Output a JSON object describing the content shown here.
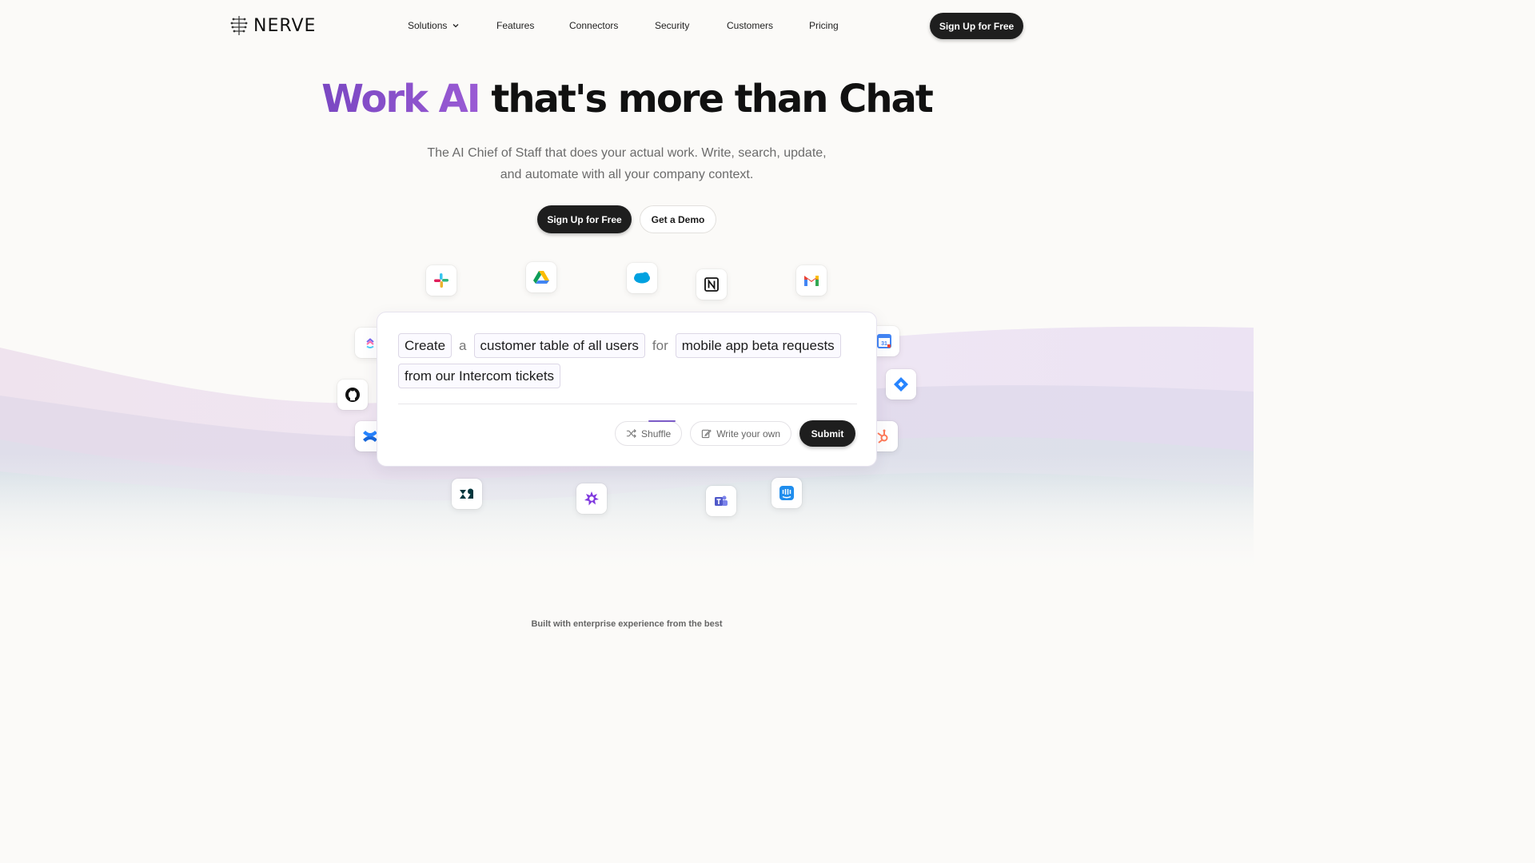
{
  "nav": {
    "logo_text": "NERVE",
    "links": [
      {
        "label": "Solutions",
        "has_dropdown": true
      },
      {
        "label": "Features"
      },
      {
        "label": "Connectors"
      },
      {
        "label": "Security"
      },
      {
        "label": "Customers"
      },
      {
        "label": "Pricing"
      }
    ],
    "cta_label": "Sign Up for Free"
  },
  "hero": {
    "title_accent": "Work AI",
    "title_rest": " that's more than Chat",
    "subtitle_line1": "The AI Chief of Staff that does your actual work. Write, search, update,",
    "subtitle_line2": "and automate with all your company context.",
    "primary_button": "Sign Up for Free",
    "secondary_button": "Get a Demo"
  },
  "connectors": [
    {
      "name": "slack-icon"
    },
    {
      "name": "google-drive-icon"
    },
    {
      "name": "salesforce-icon"
    },
    {
      "name": "notion-icon"
    },
    {
      "name": "gmail-icon"
    },
    {
      "name": "clickup-icon"
    },
    {
      "name": "google-calendar-icon",
      "label": "31"
    },
    {
      "name": "github-icon"
    },
    {
      "name": "jira-icon"
    },
    {
      "name": "confluence-icon"
    },
    {
      "name": "hubspot-icon"
    },
    {
      "name": "zendesk-icon"
    },
    {
      "name": "gong-icon"
    },
    {
      "name": "teams-icon"
    },
    {
      "name": "intercom-icon"
    }
  ],
  "prompt_builder": {
    "tokens": [
      {
        "text": "Create",
        "chip": true
      },
      {
        "text": "a",
        "chip": false
      },
      {
        "text": "customer table of all users",
        "chip": true
      },
      {
        "text": "for",
        "chip": false
      },
      {
        "text": "mobile app beta requests",
        "chip": true
      },
      {
        "text": "from our Intercom tickets",
        "chip": true
      }
    ],
    "shuffle_label": "Shuffle",
    "write_label": "Write your own",
    "submit_label": "Submit"
  },
  "footer_note": "Built with enterprise experience from the best",
  "colors": {
    "accent": "#7a47c2",
    "dark": "#1e1e1e",
    "background": "#fbfaf8"
  }
}
